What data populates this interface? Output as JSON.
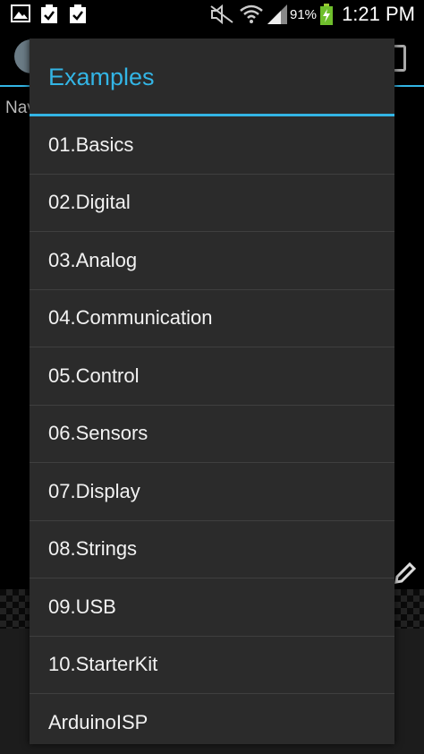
{
  "status_bar": {
    "time": "1:21 PM",
    "battery_percent": "91%",
    "icons": [
      "image-icon",
      "clipboard-check-icon",
      "clipboard-check-icon",
      "mute-icon",
      "wifi-icon",
      "signal-icon",
      "battery-charging-icon"
    ]
  },
  "background": {
    "nav_text": "Nav"
  },
  "dialog": {
    "title": "Examples",
    "items": [
      {
        "label": "01.Basics"
      },
      {
        "label": "02.Digital"
      },
      {
        "label": "03.Analog"
      },
      {
        "label": "04.Communication"
      },
      {
        "label": "05.Control"
      },
      {
        "label": "06.Sensors"
      },
      {
        "label": "07.Display"
      },
      {
        "label": "08.Strings"
      },
      {
        "label": "09.USB"
      },
      {
        "label": "10.StarterKit"
      },
      {
        "label": "ArduinoISP"
      }
    ]
  },
  "colors": {
    "accent": "#33b5e5",
    "dialog_bg": "#2b2b2b",
    "divider": "#3f3f3f"
  }
}
